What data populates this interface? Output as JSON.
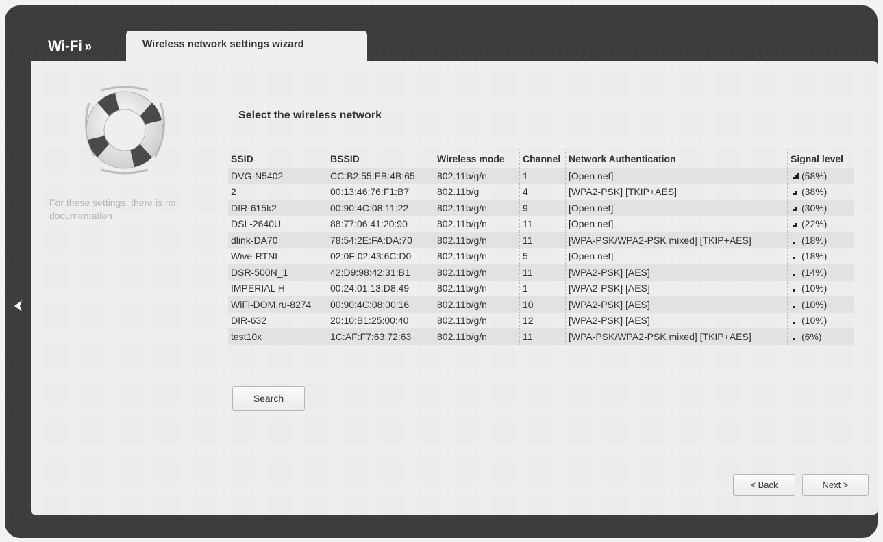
{
  "header": {
    "section_title": "Wi-Fi",
    "section_separator": "»",
    "tab_label": "Wireless network settings wizard"
  },
  "sidebar": {
    "no_documentation_text": "For these settings, there is no documentation"
  },
  "main": {
    "heading": "Select the wireless network",
    "columns": [
      "SSID",
      "BSSID",
      "Wireless mode",
      "Channel",
      "Network Authentication",
      "Signal level"
    ],
    "rows": [
      {
        "ssid": "DVG-N5402",
        "bssid": "CC:B2:55:EB:4B:65",
        "mode": "802.11b/g/n",
        "channel": "1",
        "auth": "[Open net]",
        "signal": "(58%)",
        "signal_bars": 3
      },
      {
        "ssid": "2",
        "bssid": "00:13:46:76:F1:B7",
        "mode": "802.11b/g",
        "channel": "4",
        "auth": "[WPA2-PSK] [TKIP+AES]",
        "signal": "(38%)",
        "signal_bars": 2
      },
      {
        "ssid": "DIR-615k2",
        "bssid": "00:90:4C:08:11:22",
        "mode": "802.11b/g/n",
        "channel": "9",
        "auth": "[Open net]",
        "signal": "(30%)",
        "signal_bars": 2
      },
      {
        "ssid": "DSL-2640U",
        "bssid": "88:77:06:41:20:90",
        "mode": "802.11b/g/n",
        "channel": "11",
        "auth": "[Open net]",
        "signal": "(22%)",
        "signal_bars": 2
      },
      {
        "ssid": "dlink-DA70",
        "bssid": "78:54:2E:FA:DA:70",
        "mode": "802.11b/g/n",
        "channel": "11",
        "auth": "[WPA-PSK/WPA2-PSK mixed] [TKIP+AES]",
        "signal": "(18%)",
        "signal_bars": 1
      },
      {
        "ssid": "Wive-RTNL",
        "bssid": "02:0F:02:43:6C:D0",
        "mode": "802.11b/g/n",
        "channel": "5",
        "auth": "[Open net]",
        "signal": "(18%)",
        "signal_bars": 1
      },
      {
        "ssid": "DSR-500N_1",
        "bssid": "42:D9:98:42:31:B1",
        "mode": "802.11b/g/n",
        "channel": "11",
        "auth": "[WPA2-PSK] [AES]",
        "signal": "(14%)",
        "signal_bars": 1
      },
      {
        "ssid": "IMPERIAL H",
        "bssid": "00:24:01:13:D8:49",
        "mode": "802.11b/g/n",
        "channel": "1",
        "auth": "[WPA2-PSK] [AES]",
        "signal": "(10%)",
        "signal_bars": 1
      },
      {
        "ssid": "WiFi-DOM.ru-8274",
        "bssid": "00:90:4C:08:00:16",
        "mode": "802.11b/g/n",
        "channel": "10",
        "auth": "[WPA2-PSK] [AES]",
        "signal": "(10%)",
        "signal_bars": 1
      },
      {
        "ssid": "DIR-632",
        "bssid": "20:10:B1:25:00:40",
        "mode": "802.11b/g/n",
        "channel": "12",
        "auth": "[WPA2-PSK] [AES]",
        "signal": "(10%)",
        "signal_bars": 1
      },
      {
        "ssid": "test10x",
        "bssid": "1C:AF:F7:63:72:63",
        "mode": "802.11b/g/n",
        "channel": "11",
        "auth": "[WPA-PSK/WPA2-PSK mixed] [TKIP+AES]",
        "signal": "(6%)",
        "signal_bars": 1
      }
    ],
    "search_label": "Search"
  },
  "footer": {
    "back_label": "< Back",
    "next_label": "Next >"
  },
  "icons": {
    "left_arrow": "chevron-left-icon",
    "help": "lifebuoy-icon",
    "signal": "signal-bars-icon"
  },
  "colors": {
    "frame": "#3b3b3b",
    "panel": "#efefef",
    "row_stripe": "#e2e2e2"
  }
}
